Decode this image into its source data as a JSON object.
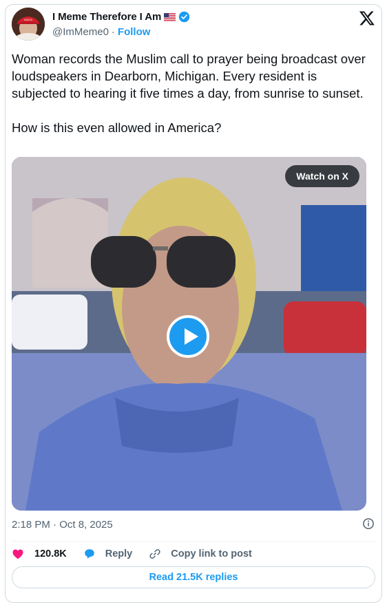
{
  "author": {
    "display_name": "I Meme Therefore I Am",
    "handle": "@ImMeme0",
    "separator": "·",
    "follow_label": "Follow",
    "flag_icon": "us-flag-icon",
    "verified_icon": "verified-badge-icon"
  },
  "tweet": {
    "text": "Woman records the Muslim call to prayer being broadcast over loudspeakers in Dearborn, Michigan. Every resident is subjected to hearing it five times a day, from sunrise to sunset.\n\nHow is this even allowed in America?",
    "timestamp": "2:18 PM · Oct 8, 2025"
  },
  "media": {
    "watch_label": "Watch on X",
    "play_icon": "play-icon"
  },
  "actions": {
    "like_count": "120.8K",
    "reply_label": "Reply",
    "copy_link_label": "Copy link to post",
    "read_replies_label": "Read 21.5K replies"
  },
  "colors": {
    "accent": "#1d9bf0",
    "like": "#f91880",
    "text": "#0f1419",
    "secondary": "#536471",
    "border": "#cfd9de"
  }
}
